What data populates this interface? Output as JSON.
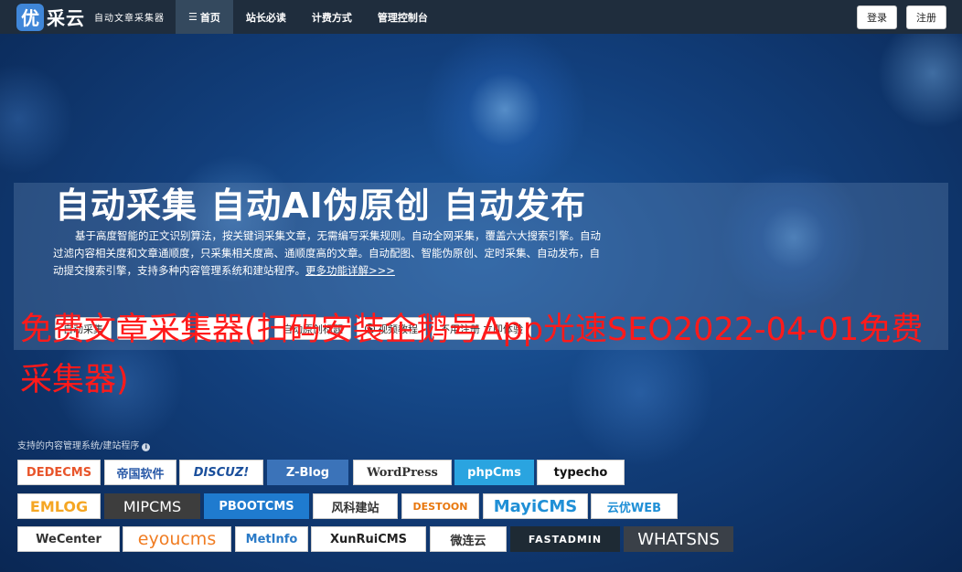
{
  "nav": {
    "logo_mark": "优",
    "logo_text": "采云",
    "logo_slogan": "自动文章采集器",
    "menu": [
      {
        "label": "首页",
        "active": true
      },
      {
        "label": "站长必读",
        "active": false
      },
      {
        "label": "计费方式",
        "active": false
      },
      {
        "label": "管理控制台",
        "active": false
      }
    ],
    "login": "登录",
    "register": "注册"
  },
  "hero": {
    "title": "自动采集 自动AI伪原创 自动发布",
    "description": "基于高度智能的正文识别算法，按关键词采集文章，无需编写采集规则。自动全网采集，覆盖六大搜索引擎。自动过滤内容相关度和文章通顺度，只采集相关度高、通顺度高的文章。自动配图、智能伪原创、定时采集、自动发布，自动提交搜索引擎，支持多种内容管理系统和建站程序。",
    "more_link": "更多功能详解>>>",
    "buttons": [
      "自动采集",
      "",
      "",
      "自动原创标题",
      "视频教程",
      "不用注册 立即体验"
    ]
  },
  "overlay_text": "免费文章采集器(扫码安装企鹅号App光速SEO2022-04-01免费采集器)",
  "cms": {
    "caption": "支持的内容管理系统/建站程序",
    "logos": [
      {
        "name": "DEDECMS",
        "color": "#e8552b"
      },
      {
        "name": "帝国软件",
        "color": "#2a5aa8"
      },
      {
        "name": "DISCUZ!",
        "color": "#1a4f9c"
      },
      {
        "name": "Z-Blog",
        "color": "#ffffff"
      },
      {
        "name": "WordPress",
        "color": "#333333"
      },
      {
        "name": "phpCms",
        "color": "#ffffff"
      },
      {
        "name": "typecho",
        "color": "#111111"
      },
      {
        "name": "EMLOG",
        "color": "#f5a623"
      },
      {
        "name": "MIPCMS",
        "color": "#ffffff"
      },
      {
        "name": "PBOOTCMS",
        "color": "#ffffff"
      },
      {
        "name": "风科建站",
        "color": "#333333"
      },
      {
        "name": "DESTOON",
        "color": "#e8770e"
      },
      {
        "name": "MayiCMS",
        "color": "#1f8fd6"
      },
      {
        "name": "云优WEB",
        "color": "#1f8fd6"
      },
      {
        "name": "WeCenter",
        "color": "#333333"
      },
      {
        "name": "eyoucms",
        "color": "#f07c22"
      },
      {
        "name": "MetInfo",
        "color": "#2a7ac7"
      },
      {
        "name": "XunRuiCMS",
        "color": "#222222"
      },
      {
        "name": "微连云",
        "color": "#333333"
      },
      {
        "name": "FASTADMIN",
        "color": "#ffffff"
      },
      {
        "name": "WHATSNS",
        "color": "#ffffff"
      }
    ]
  }
}
